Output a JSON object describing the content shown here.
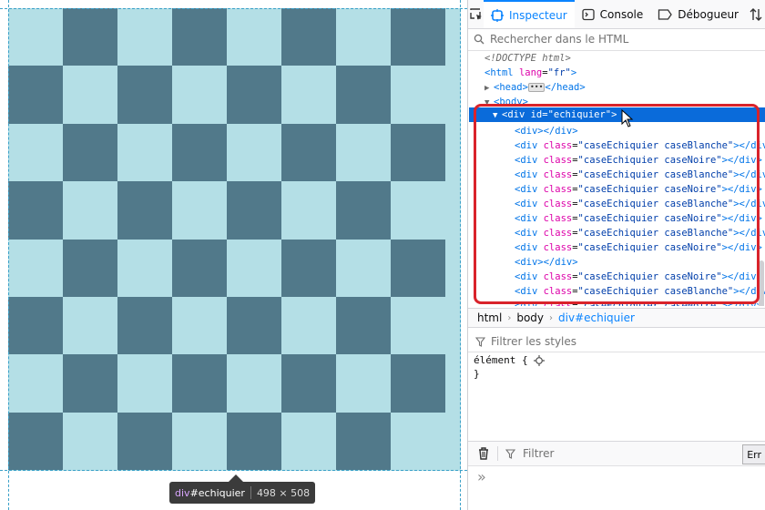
{
  "toolbar": {
    "tabs": [
      {
        "label": "Inspecteur",
        "icon": "inspector-icon",
        "active": true
      },
      {
        "label": "Console",
        "icon": "console-icon",
        "active": false
      },
      {
        "label": "Débogueur",
        "icon": "debugger-icon",
        "active": false
      }
    ]
  },
  "html_search": {
    "placeholder": "Rechercher dans le HTML"
  },
  "tree": {
    "doctype": "<!DOCTYPE html>",
    "html_lang_value": "\"fr\"",
    "head_tag": "head",
    "body_tag": "body",
    "selected_id_value": "\"echiquier\"",
    "rows": [
      {
        "type": "empty"
      },
      {
        "type": "case",
        "cls": "\"caseEchiquier caseBlanche\""
      },
      {
        "type": "case",
        "cls": "\"caseEchiquier caseNoire\""
      },
      {
        "type": "case",
        "cls": "\"caseEchiquier caseBlanche\""
      },
      {
        "type": "case",
        "cls": "\"caseEchiquier caseNoire\""
      },
      {
        "type": "case",
        "cls": "\"caseEchiquier caseBlanche\""
      },
      {
        "type": "case",
        "cls": "\"caseEchiquier caseNoire\""
      },
      {
        "type": "case",
        "cls": "\"caseEchiquier caseBlanche\""
      },
      {
        "type": "case",
        "cls": "\"caseEchiquier caseNoire\""
      },
      {
        "type": "empty"
      },
      {
        "type": "case",
        "cls": "\"caseEchiquier caseNoire\""
      },
      {
        "type": "case",
        "cls": "\"caseEchiquier caseBlanche\""
      },
      {
        "type": "case",
        "cls": "\"caseEchiquier caseNoire\""
      }
    ]
  },
  "breadcrumbs": [
    "html",
    "body",
    "div#echiquier"
  ],
  "styles": {
    "filter_placeholder": "Filtrer les styles",
    "rule_selector": "élément {",
    "rule_close": "}"
  },
  "console": {
    "filter_placeholder": "Filtrer",
    "errors_label": "Err",
    "prompt": "»"
  },
  "tooltip": {
    "tag": "div",
    "selector": "#echiquier",
    "size": "498 × 508"
  },
  "board": {
    "rows": 8,
    "cols": 8,
    "dark_color": "#51798a",
    "light_color": "#b4dfe6"
  },
  "colors": {
    "accent": "#0a84ff",
    "selection": "#0a6bda",
    "annotation_red": "#d9232b"
  }
}
